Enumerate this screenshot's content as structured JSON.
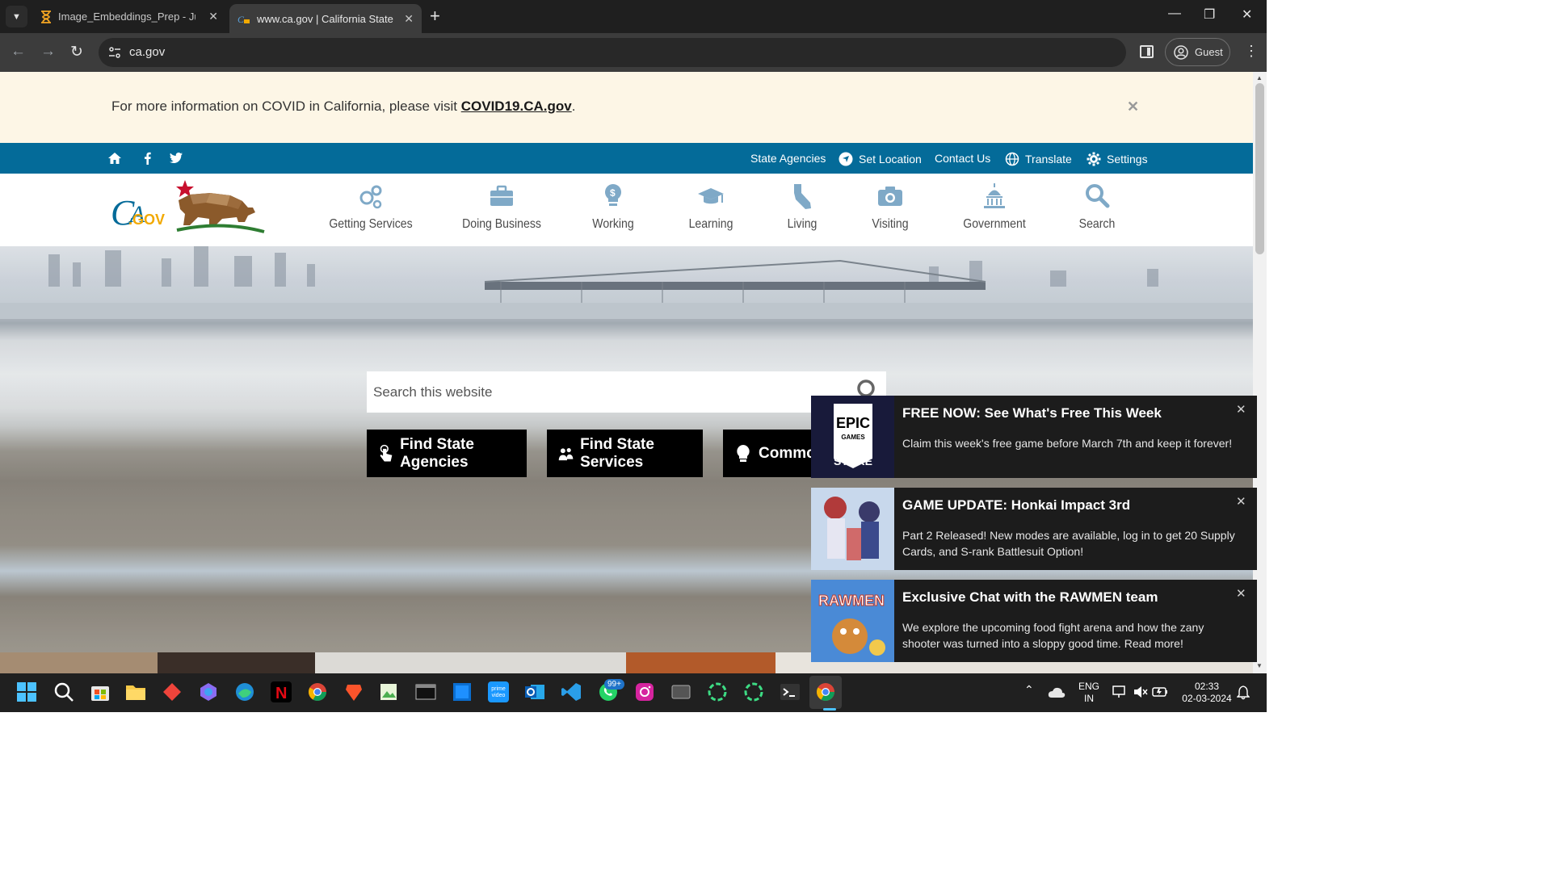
{
  "browser": {
    "tabs": [
      {
        "title": "Image_Embeddings_Prep - Jupyter",
        "icon": "hourglass-icon"
      },
      {
        "title": "www.ca.gov | California State Portal",
        "icon": "ca-gov-icon"
      }
    ],
    "address": "ca.gov",
    "profile_label": "Guest"
  },
  "covid_banner": {
    "text": "For more information on COVID in California, please visit ",
    "link": "COVID19.CA.gov",
    "trailing": "."
  },
  "utility": {
    "state_agencies": "State Agencies",
    "set_location": "Set Location",
    "contact_us": "Contact Us",
    "translate": "Translate",
    "settings": "Settings"
  },
  "logo": {
    "text": "CA.GOV"
  },
  "nav": [
    {
      "label": "Getting Services",
      "icon": "gears-icon"
    },
    {
      "label": "Doing Business",
      "icon": "briefcase-icon"
    },
    {
      "label": "Working",
      "icon": "lightbulb-dollar-icon"
    },
    {
      "label": "Learning",
      "icon": "graduation-cap-icon"
    },
    {
      "label": "Living",
      "icon": "california-map-icon"
    },
    {
      "label": "Visiting",
      "icon": "camera-icon"
    },
    {
      "label": "Government",
      "icon": "capitol-dome-icon"
    },
    {
      "label": "Search",
      "icon": "search-icon"
    }
  ],
  "hero": {
    "search_placeholder": "Search this website",
    "buttons": [
      {
        "label": "Find State Agencies",
        "icon": "touch-hand-icon"
      },
      {
        "label": "Find State Services",
        "icon": "people-icon"
      },
      {
        "label": "Common",
        "icon": "lightbulb-icon"
      }
    ]
  },
  "notifications": [
    {
      "title": "FREE NOW: See What's Free This Week",
      "body": "Claim this week's free game before March 7th and keep it forever!",
      "thumb": "Epic Games Store",
      "thumb_top": "EPIC",
      "thumb_mid": "GAMES",
      "thumb_bottom": "STORE"
    },
    {
      "title": "GAME UPDATE: Honkai Impact 3rd",
      "body": "Part 2 Released! New modes are available, log in to get 20 Supply Cards, and S-rank Battlesuit Option!",
      "thumb": "Honkai Impact art"
    },
    {
      "title": "Exclusive Chat with the RAWMEN team",
      "body": "We explore the upcoming food fight arena and how the zany shooter was turned into a sloppy good time. Read more!",
      "thumb": "RAWMEN art",
      "thumb_text": "RAWMEN"
    }
  ],
  "taskbar": {
    "whatsapp_badge": "99+",
    "lang_top": "ENG",
    "lang_bottom": "IN",
    "time": "02:33",
    "date": "02-03-2024"
  },
  "colors": {
    "utility_bar": "#046b99",
    "covid_bg": "#fdf6e6",
    "ca_blue": "#046b99",
    "ca_gold": "#f2a900"
  }
}
